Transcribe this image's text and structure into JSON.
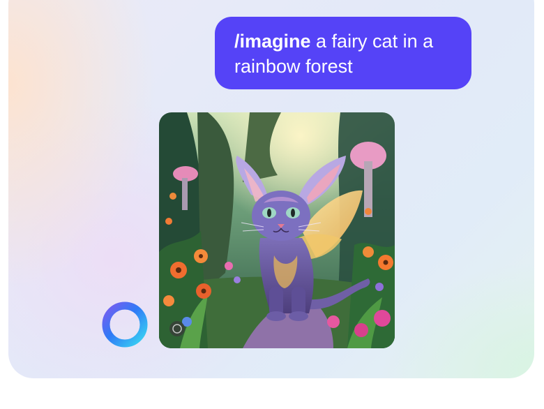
{
  "chat": {
    "user_message": {
      "command": "/imagine",
      "prompt": " a fairy cat in a rainbow forest",
      "bubble_color": "#5543f7"
    },
    "generated_image": {
      "subject": "fairy cat in a rainbow forest",
      "icon": "generated-image"
    },
    "assistant_avatar": {
      "icon": "ring-loader-icon",
      "colors": [
        "#3b7bf5",
        "#9a5cf0",
        "#44d0f0"
      ]
    }
  }
}
